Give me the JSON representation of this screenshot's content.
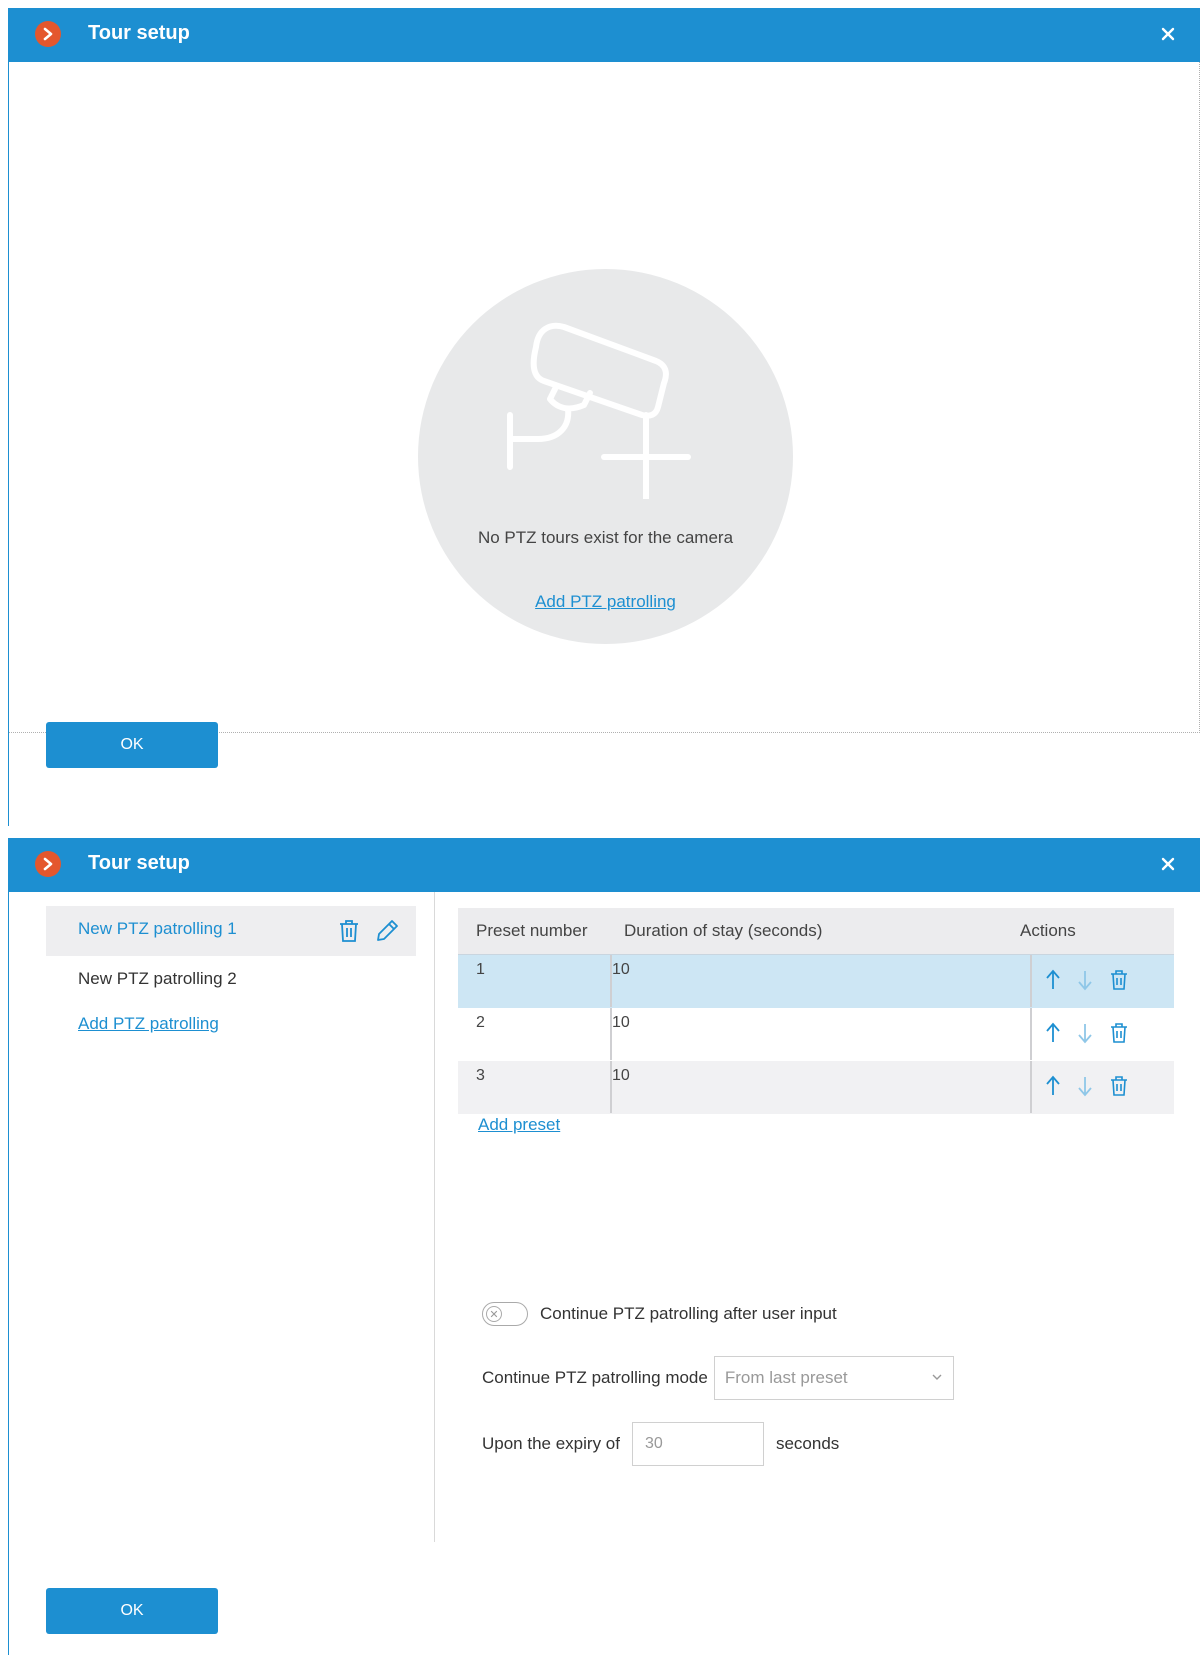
{
  "dialog1": {
    "title": "Tour setup",
    "empty_text": "No PTZ tours exist for the camera",
    "add_link": "Add PTZ patrolling",
    "ok_label": "OK"
  },
  "dialog2": {
    "title": "Tour setup",
    "patrollings": [
      {
        "name": "New PTZ patrolling 1",
        "selected": true
      },
      {
        "name": "New PTZ patrolling 2",
        "selected": false
      }
    ],
    "add_link": "Add PTZ patrolling",
    "table": {
      "headers": [
        "Preset number",
        "Duration of stay (seconds)",
        "Actions"
      ],
      "rows": [
        {
          "preset": "1",
          "duration": "10"
        },
        {
          "preset": "2",
          "duration": "10"
        },
        {
          "preset": "3",
          "duration": "10"
        }
      ]
    },
    "add_preset": "Add preset",
    "continue_toggle_label": "Continue PTZ patrolling after user input",
    "continue_toggle_on": false,
    "mode_label": "Continue PTZ patrolling mode",
    "mode_value": "From last preset",
    "expiry_label": "Upon the expiry of",
    "expiry_value": "30",
    "expiry_unit": "seconds",
    "ok_label": "OK"
  },
  "colors": {
    "accent": "#1d8fd1",
    "logo": "#e4572e",
    "selected_row": "#cde6f4"
  }
}
